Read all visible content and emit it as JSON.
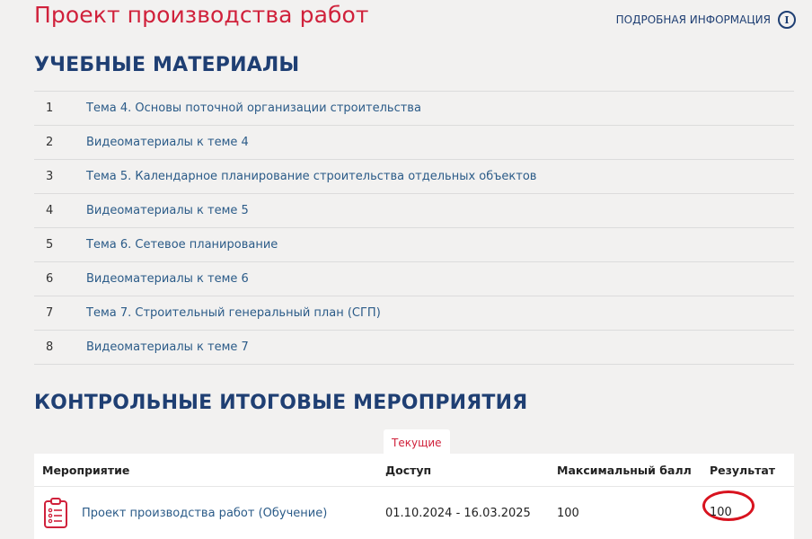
{
  "header": {
    "title": "Проект производства работ",
    "info_link": "ПОДРОБНАЯ ИНФОРМАЦИЯ",
    "info_icon": "info-circle-icon"
  },
  "materials": {
    "heading": "УЧЕБНЫЕ МАТЕРИАЛЫ",
    "items": [
      {
        "num": "1",
        "label": "Тема 4. Основы поточной организации строительства"
      },
      {
        "num": "2",
        "label": "Видеоматериалы к теме 4"
      },
      {
        "num": "3",
        "label": "Тема 5. Календарное планирование строительства отдельных объектов"
      },
      {
        "num": "4",
        "label": "Видеоматериалы к теме 5"
      },
      {
        "num": "5",
        "label": "Тема 6. Сетевое планирование"
      },
      {
        "num": "6",
        "label": "Видеоматериалы к теме 6"
      },
      {
        "num": "7",
        "label": "Тема 7. Строительный генеральный план (СГП)"
      },
      {
        "num": "8",
        "label": "Видеоматериалы к теме 7"
      }
    ]
  },
  "events": {
    "heading": "КОНТРОЛЬНЫЕ ИТОГОВЫЕ МЕРОПРИЯТИЯ",
    "tab": "Текущие",
    "columns": [
      "Мероприятие",
      "Доступ",
      "Максимальный балл",
      "Результат"
    ],
    "rows": [
      {
        "icon": "clipboard-list-icon",
        "name": "Проект производства работ (Обучение)",
        "access": "01.10.2024 - 16.03.2025",
        "max_score": "100",
        "result": "100"
      }
    ]
  },
  "colors": {
    "brand_red": "#d0213b",
    "heading_blue": "#1f3f73",
    "link_blue": "#2b5b88",
    "annotation_red": "#d8131f",
    "background": "#f2f1f0"
  }
}
